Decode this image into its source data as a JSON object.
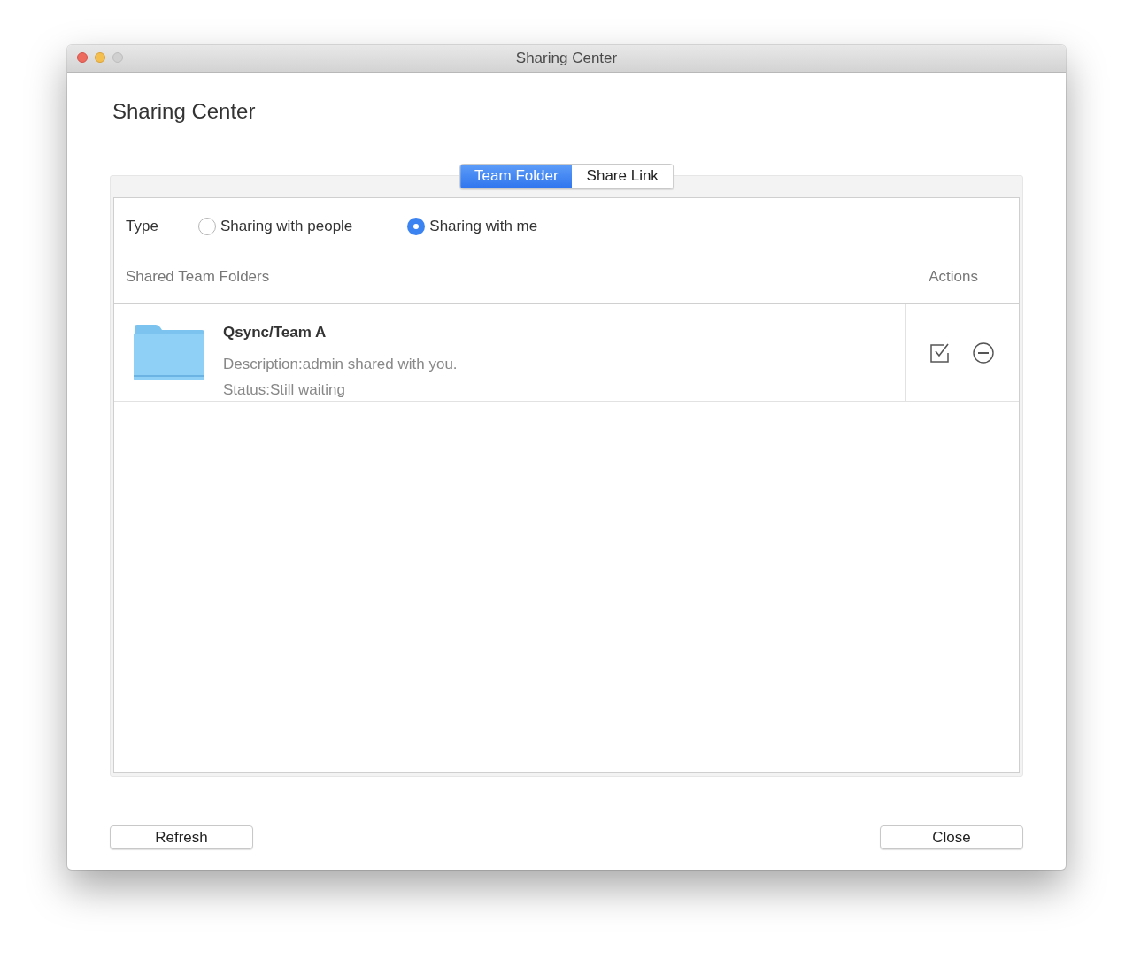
{
  "window": {
    "title": "Sharing Center",
    "controls": [
      {
        "kind": "close",
        "disabled": false
      },
      {
        "kind": "minimize",
        "disabled": false
      },
      {
        "kind": "zoom",
        "disabled": true
      }
    ]
  },
  "heading": "Sharing Center",
  "tabs": [
    {
      "label": "Team Folder",
      "selected": true
    },
    {
      "label": "Share Link",
      "selected": false
    }
  ],
  "type_filter": {
    "label": "Type",
    "options": [
      {
        "label": "Sharing with people",
        "selected": false
      },
      {
        "label": "Sharing with me",
        "selected": true
      }
    ]
  },
  "list": {
    "columns": [
      "Shared Team Folders",
      "Actions"
    ],
    "rows": [
      {
        "name": "Qsync/Team A",
        "description": "Description:admin shared with you.",
        "status": "Status:Still waiting"
      }
    ]
  },
  "buttons": [
    "Refresh",
    "Close"
  ]
}
